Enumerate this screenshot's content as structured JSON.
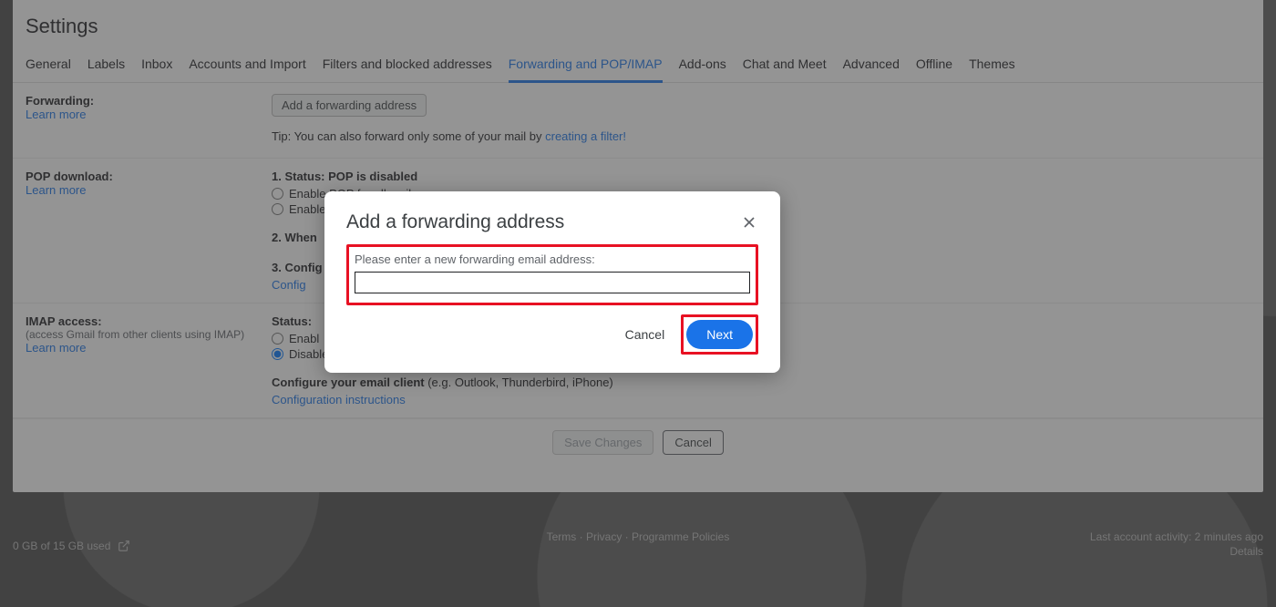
{
  "page_title": "Settings",
  "tabs": [
    "General",
    "Labels",
    "Inbox",
    "Accounts and Import",
    "Filters and blocked addresses",
    "Forwarding and POP/IMAP",
    "Add-ons",
    "Chat and Meet",
    "Advanced",
    "Offline",
    "Themes"
  ],
  "forwarding": {
    "label": "Forwarding:",
    "learn": "Learn more",
    "button": "Add a forwarding address",
    "tip_prefix": "Tip: You can also forward only some of your mail by ",
    "tip_link": "creating a filter!"
  },
  "pop": {
    "label": "POP download:",
    "learn": "Learn more",
    "status_prefix": "1. Status: ",
    "status_value": "POP is disabled",
    "opt_all": "Enable POP for all mail",
    "opt_now": "Enable",
    "when_label": "2. When",
    "config_label": "3. Config",
    "config_link": "Config"
  },
  "imap": {
    "label": "IMAP access:",
    "sub": "(access Gmail from other clients using IMAP)",
    "learn": "Learn more",
    "status_label": "Status: ",
    "enable": "Enabl",
    "disable": "Disable IMAP",
    "config_label": "Configure your email client ",
    "config_hint": "(e.g. Outlook, Thunderbird, iPhone)",
    "config_link": "Configuration instructions"
  },
  "buttons": {
    "save": "Save Changes",
    "cancel": "Cancel"
  },
  "footer": {
    "terms": "Terms",
    "privacy": "Privacy",
    "policies": "Programme Policies",
    "activity": "Last account activity: 2 minutes ago",
    "details": "Details",
    "storage": "0 GB of 15 GB used"
  },
  "dialog": {
    "title": "Add a forwarding address",
    "prompt": "Please enter a new forwarding email address:",
    "cancel": "Cancel",
    "next": "Next",
    "value": ""
  }
}
